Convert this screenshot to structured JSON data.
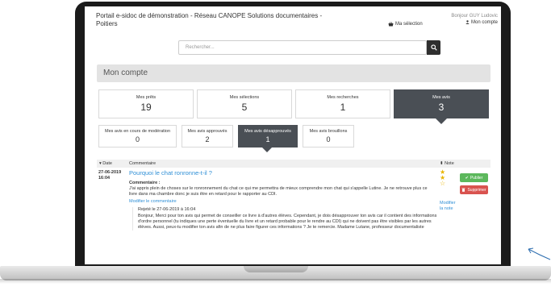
{
  "header": {
    "site_title": "Portail e-sidoc de démonstration - Réseau CANOPE Solutions documentaires - Poitiers",
    "selection_link": "Ma sélection",
    "user_name": "Bonjour GUY Ludovic",
    "account_link": "Mon compte"
  },
  "search": {
    "placeholder": "Rechercher..."
  },
  "page_title": "Mon compte",
  "stats": [
    {
      "label": "Mes prêts",
      "value": "19"
    },
    {
      "label": "Mes sélections",
      "value": "5"
    },
    {
      "label": "Mes recherches",
      "value": "1"
    },
    {
      "label": "Mes avis",
      "value": "3"
    }
  ],
  "subtabs": [
    {
      "label": "Mes avis en cours de modération",
      "value": "0"
    },
    {
      "label": "Mes avis approuvés",
      "value": "2"
    },
    {
      "label": "Mes avis désapprouvés",
      "value": "1"
    },
    {
      "label": "Mes avis brouillons",
      "value": "0"
    }
  ],
  "table": {
    "col_date": "Date",
    "col_comment": "Commentaire",
    "col_rating": "Note",
    "row": {
      "date": "27-06-2019",
      "time": "16:04",
      "title": "Pourquoi le chat ronronne-t-il ?",
      "comment_label": "Commentaire :",
      "comment_text": "J'ai appris plein de choses sur le ronronnement du chat ce qui me permettra de mieux comprendre mon chat qui s'appelle Lutine. Je ne retrouve plus ce livre dans ma chambre donc je suis être en retard pour le rapporter au CDI.",
      "edit_comment": "Modifier le commentaire",
      "rejected_label": "Rejeté le 27-06-2019 à 16:04",
      "rejected_text": "Bonjour, Merci pour ton avis qui permet de conseiller ce livre à d'autres élèves. Cependant, je dois désapprouver ton avis car il contient des informations d'ordre personnel (tu indiques une perte éventuelle du livre et un retard probable pour le rendre au CDI) qui ne doivent pas être visibles par les autres élèves. Aussi, peux-tu modifier ton avis afin de ne plus faire figurer ces informations ? Je te remercie. Madame Lutane, professeur documentaliste",
      "rating": 2,
      "rating_max": 3,
      "edit_rating": "Modifier la note",
      "publish_label": "Publier",
      "delete_label": "Supprimer"
    }
  },
  "colors": {
    "accent": "#2f8fd6",
    "active_tab": "#4a4f55",
    "publish": "#5cb85c",
    "delete": "#d9534f",
    "star": "#e8b400"
  },
  "icons": [
    "basket-icon",
    "user-icon",
    "search-icon",
    "sort-icon",
    "check-icon",
    "trash-icon",
    "star-icon"
  ]
}
